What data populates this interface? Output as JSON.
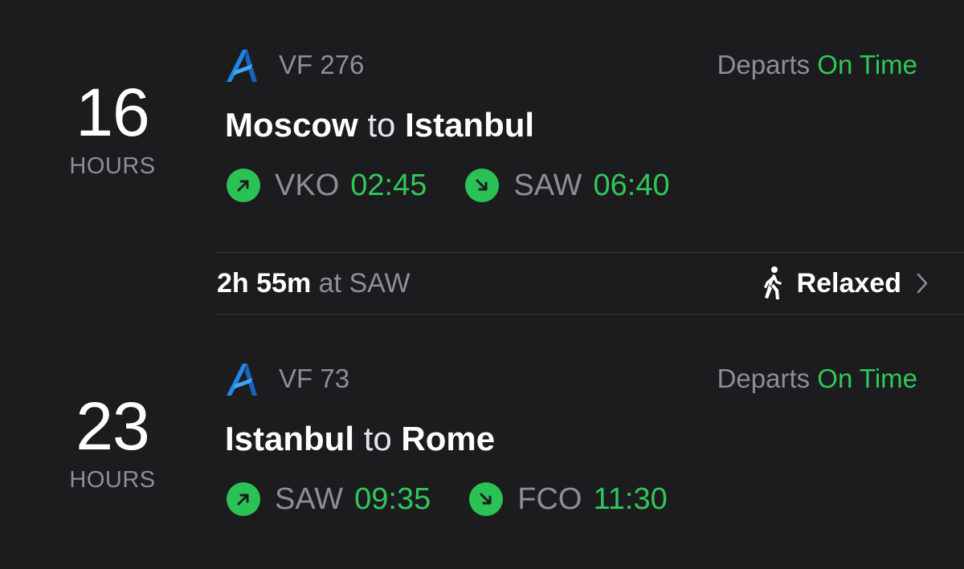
{
  "flights": [
    {
      "countdown_value": "16",
      "countdown_unit": "HOURS",
      "flight_number": "VF 276",
      "status_prefix": "Departs",
      "status": "On Time",
      "origin_city": "Moscow",
      "connector": "to",
      "destination_city": "Istanbul",
      "departure": {
        "airport": "VKO",
        "time": "02:45"
      },
      "arrival": {
        "airport": "SAW",
        "time": "06:40"
      }
    },
    {
      "countdown_value": "23",
      "countdown_unit": "HOURS",
      "flight_number": "VF 73",
      "status_prefix": "Departs",
      "status": "On Time",
      "origin_city": "Istanbul",
      "connector": "to",
      "destination_city": "Rome",
      "departure": {
        "airport": "SAW",
        "time": "09:35"
      },
      "arrival": {
        "airport": "FCO",
        "time": "11:30"
      }
    }
  ],
  "layover": {
    "duration": "2h 55m",
    "location": "at SAW",
    "pace": "Relaxed"
  },
  "icons": {
    "airline_logo": "airline-logo-icon",
    "departure": "departure-arrow-icon",
    "arrival": "arrival-arrow-icon",
    "walking": "walking-person-icon",
    "chevron": "chevron-right-icon"
  },
  "colors": {
    "background": "#1c1c1e",
    "accent_green": "#30c75a",
    "secondary_text": "#8e8e93",
    "logo_blue": "#1e88e5"
  }
}
